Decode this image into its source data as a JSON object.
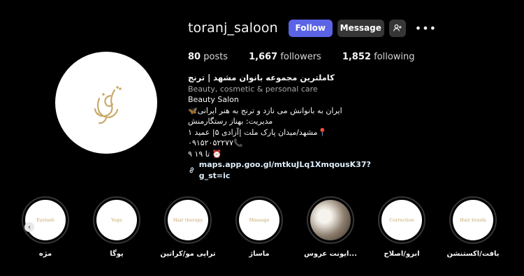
{
  "profile": {
    "username": "toranj_saloon",
    "follow_label": "Follow",
    "message_label": "Message",
    "more_label": "•••"
  },
  "stats": {
    "posts_count": "80",
    "posts_label": "posts",
    "followers_count": "1,667",
    "followers_label": "followers",
    "following_count": "1,852",
    "following_label": "following"
  },
  "bio": {
    "name": "کاملترین مجموعه بانوان مشهد | ترنج",
    "category": "Beauty, cosmetic & personal care",
    "line1": "Beauty Salon",
    "line2": "🦋ایران به بانوانش می نازد و ترنج به هنر ایرانی",
    "line3": "مدیریت: بهناز رستگارمنش",
    "line4": "مشهد/میدان پارک ملت |آزادی ۵| عمید ۱📍",
    "line5": "۰۹۱۵۲۰۵۲۲۷۷📞",
    "line6": "۹ تا ۱۹ ⏰",
    "link": "maps.app.goo.gl/mtkuJLq1XmqousK37?g_st=ic"
  },
  "highlights": [
    {
      "inner": "Eyelash",
      "caption": "مژه"
    },
    {
      "inner": "Yoga",
      "caption": "یوگا"
    },
    {
      "inner": "Hair therapy",
      "caption": "تراپی مو/کراتین"
    },
    {
      "inner": "Massage",
      "caption": "ماساژ"
    },
    {
      "inner": "",
      "caption": "ایونت عروس..."
    },
    {
      "inner": "Correction",
      "caption": "ابرو/اصلاح"
    },
    {
      "inner": "Hair braids",
      "caption": "بافت/اکستنشن"
    }
  ],
  "icons": {
    "add_person": "add-person-icon",
    "link": "link-icon",
    "prev": "chevron-left-icon"
  },
  "colors": {
    "follow_button": "#5b63e6",
    "secondary_button": "#363636",
    "highlight_text": "#c9a96e"
  }
}
